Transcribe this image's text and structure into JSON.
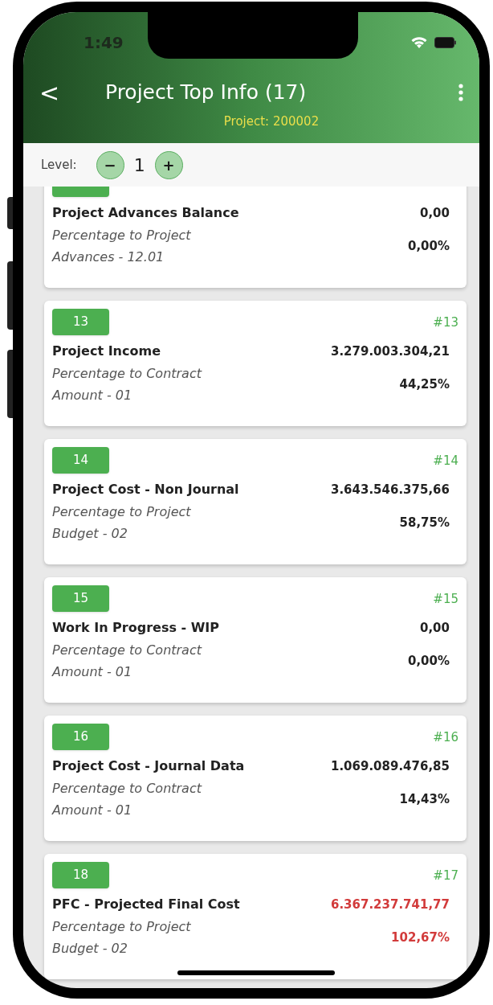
{
  "status_bar": {
    "time": "1:49"
  },
  "header": {
    "back_icon": "<",
    "title": "Project Top Info (17)",
    "subtitle": "Project: 200002"
  },
  "level_bar": {
    "label": "Level:",
    "minus": "−",
    "value": "1",
    "plus": "+"
  },
  "cards": [
    {
      "title": "Project Advances Balance",
      "value": "0,00",
      "description": "Percentage to Project Advances - 12.01",
      "percent": "0,00%",
      "alert": false
    },
    {
      "badge": "13",
      "number": "#13",
      "title": "Project Income",
      "value": "3.279.003.304,21",
      "description": "Percentage to Contract Amount - 01",
      "percent": "44,25%",
      "alert": false
    },
    {
      "badge": "14",
      "number": "#14",
      "title": "Project Cost - Non Journal",
      "value": "3.643.546.375,66",
      "description": "Percentage to Project Budget - 02",
      "percent": "58,75%",
      "alert": false
    },
    {
      "badge": "15",
      "number": "#15",
      "title": "Work In Progress - WIP",
      "value": "0,00",
      "description": "Percentage to Contract Amount - 01",
      "percent": "0,00%",
      "alert": false
    },
    {
      "badge": "16",
      "number": "#16",
      "title": "Project Cost - Journal Data",
      "value": "1.069.089.476,85",
      "description": "Percentage to Contract Amount - 01",
      "percent": "14,43%",
      "alert": false
    },
    {
      "badge": "18",
      "number": "#17",
      "title": "PFC - Projected Final Cost",
      "value": "6.367.237.741,77",
      "description": "Percentage to Project Budget - 02",
      "percent": "102,67%",
      "alert": true
    }
  ]
}
